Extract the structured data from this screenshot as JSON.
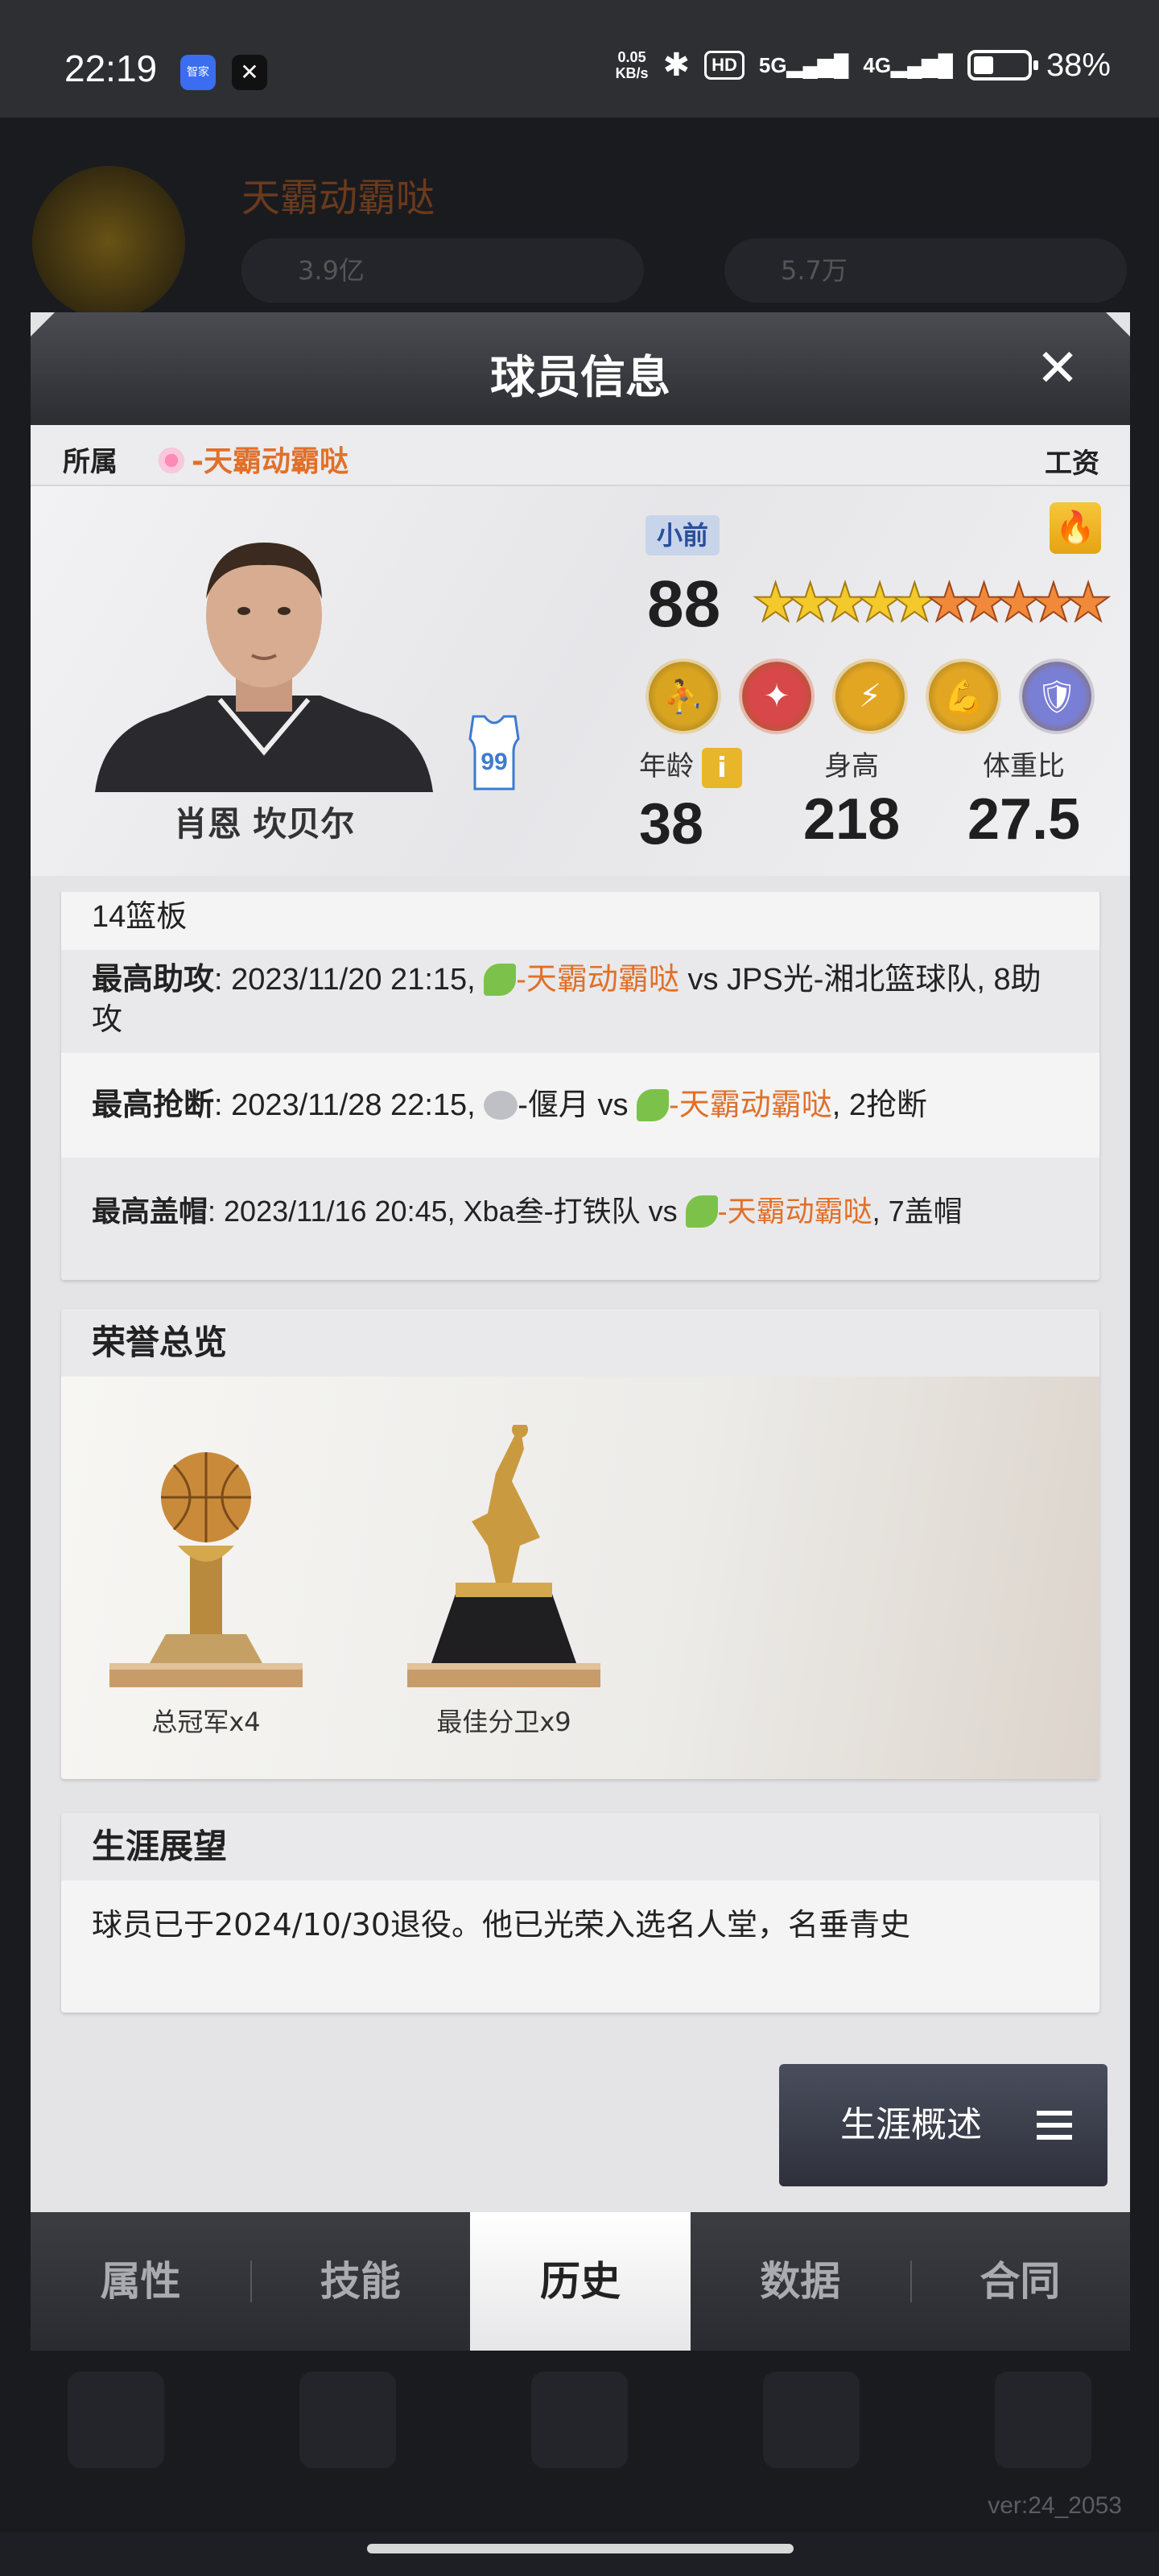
{
  "status_bar": {
    "time": "22:19",
    "app1_label": "智家",
    "net_speed_top": "0.05",
    "net_speed_bottom": "KB/s",
    "hd_label": "HD",
    "signal1": "5G",
    "signal2": "4G",
    "battery_percent": "38%",
    "battery_level": 0.38
  },
  "background": {
    "team_name": "天霸动霸哒",
    "coins": "3.9亿",
    "gems": "5.7万",
    "version": "ver:24_2053"
  },
  "modal": {
    "title": "球员信息",
    "close_icon": "close-icon"
  },
  "belong": {
    "label": "所属",
    "team_prefix": "-",
    "team_name": "天霸动霸哒",
    "salary_label": "工资"
  },
  "player": {
    "name": "肖恩 坎贝尔",
    "jersey_number": "99",
    "position": "小前",
    "rating": "88",
    "stars_gold": 5,
    "stars_orange": 5,
    "skills": [
      {
        "icon": "shooter-skill-icon",
        "color": "#d9a520"
      },
      {
        "icon": "dribble-skill-icon",
        "color": "#d8474a"
      },
      {
        "icon": "speed-skill-icon",
        "color": "#e2a623"
      },
      {
        "icon": "strength-skill-icon",
        "color": "#e2a623"
      },
      {
        "icon": "defense-skill-icon",
        "color": "#7a7fd6"
      }
    ],
    "age_label": "年龄",
    "age": "38",
    "height_label": "身高",
    "height": "218",
    "weight_label": "体重比",
    "weight_ratio": "27.5"
  },
  "records": {
    "partial_top": "14篮板",
    "assists": {
      "label": "最高助攻",
      "text_a": ": 2023/11/20 21:15, ",
      "team": "-天霸动霸哒",
      "text_b": " vs JPS光-湘北篮球队, 8助攻"
    },
    "steals": {
      "label": "最高抢断",
      "text_a": ": 2023/11/28 22:15, ",
      "opp": "-偃月 vs ",
      "team": "-天霸动霸哒",
      "text_b": ", 2抢断"
    },
    "blocks": {
      "label": "最高盖帽",
      "text_a": ": 2023/11/16 20:45, Xba叁-打铁队 vs ",
      "team": "-天霸动霸哒",
      "text_b": ", 7盖帽"
    }
  },
  "honors": {
    "title": "荣誉总览",
    "items": [
      {
        "label": "总冠军x4"
      },
      {
        "label": "最佳分卫x9"
      }
    ]
  },
  "career": {
    "title": "生涯展望",
    "text": "球员已于2024/10/30退役。他已光荣入选名人堂，名垂青史",
    "button_label": "生涯概述"
  },
  "tabs": [
    {
      "label": "属性"
    },
    {
      "label": "技能"
    },
    {
      "label": "历史"
    },
    {
      "label": "数据"
    },
    {
      "label": "合同"
    }
  ]
}
